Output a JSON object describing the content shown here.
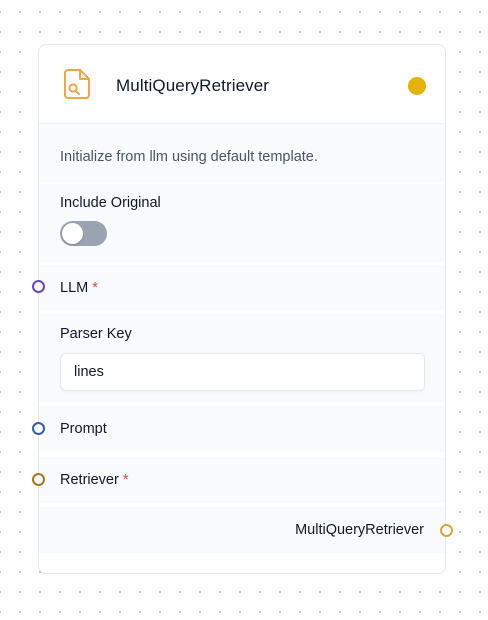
{
  "node": {
    "title": "MultiQueryRetriever",
    "description": "Initialize from llm using default template.",
    "status_color": "#e5b10b",
    "icon": "file-search-icon",
    "icon_color": "#e8a94c"
  },
  "fields": {
    "include_original": {
      "label": "Include Original",
      "value": false
    },
    "llm": {
      "label": "LLM",
      "required_mark": "*",
      "handle_color": "#6b46c1"
    },
    "parser_key": {
      "label": "Parser Key",
      "value": "lines"
    },
    "prompt": {
      "label": "Prompt",
      "handle_color": "#3b5bb5"
    },
    "retriever": {
      "label": "Retriever",
      "required_mark": "*",
      "handle_color": "#a07a2c"
    }
  },
  "output": {
    "label": "MultiQueryRetriever",
    "handle_color": "#d4a843"
  }
}
